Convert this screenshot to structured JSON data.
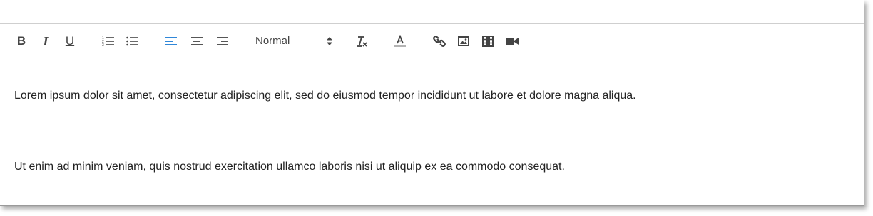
{
  "toolbar": {
    "header_select_value": "Normal",
    "icons": [
      "bold-icon",
      "italic-icon",
      "underline-icon",
      "ordered-list-icon",
      "bullet-list-icon",
      "align-left-icon",
      "align-center-icon",
      "align-right-icon",
      "clear-format-icon",
      "text-color-icon",
      "link-icon",
      "image-icon",
      "video-film-icon",
      "video-camera-icon"
    ],
    "active_icon": "align-left-icon",
    "colors": {
      "icon": "#444444",
      "active": "#1a7ad4",
      "text_color_bar": "#b3b3b3"
    }
  },
  "editor": {
    "paragraphs": [
      "Lorem ipsum dolor sit amet, consectetur adipiscing elit, sed do eiusmod tempor incididunt ut labore et dolore magna aliqua.",
      "Ut enim ad minim veniam, quis nostrud exercitation ullamco laboris nisi ut aliquip ex ea commodo consequat."
    ]
  }
}
